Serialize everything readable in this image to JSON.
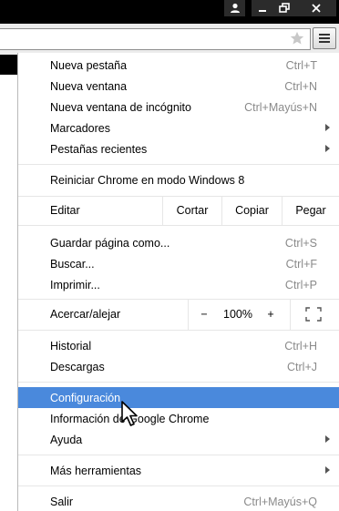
{
  "window": {
    "icons": {
      "user": "user-icon",
      "minimize": "minimize-icon",
      "restore": "restore-icon",
      "close": "close-icon"
    }
  },
  "toolbar": {
    "star_icon": "star-icon",
    "menu_icon": "hamburger-menu-icon"
  },
  "menu": {
    "group1": [
      {
        "label": "Nueva pestaña",
        "shortcut": "Ctrl+T"
      },
      {
        "label": "Nueva ventana",
        "shortcut": "Ctrl+N"
      },
      {
        "label": "Nueva ventana de incógnito",
        "shortcut": "Ctrl+Mayús+N"
      },
      {
        "label": "Marcadores",
        "shortcut": ""
      },
      {
        "label": "Pestañas recientes",
        "shortcut": ""
      }
    ],
    "restart": {
      "label": "Reiniciar Chrome en modo Windows 8"
    },
    "edit": {
      "label": "Editar",
      "cut": "Cortar",
      "copy": "Copiar",
      "paste": "Pegar"
    },
    "group2": [
      {
        "label": "Guardar página como...",
        "shortcut": "Ctrl+S"
      },
      {
        "label": "Buscar...",
        "shortcut": "Ctrl+F"
      },
      {
        "label": "Imprimir...",
        "shortcut": "Ctrl+P"
      }
    ],
    "zoom": {
      "label": "Acercar/alejar",
      "minus": "−",
      "value": "100%",
      "plus": "+"
    },
    "group3": [
      {
        "label": "Historial",
        "shortcut": "Ctrl+H"
      },
      {
        "label": "Descargas",
        "shortcut": "Ctrl+J"
      }
    ],
    "group4": [
      {
        "label": "Configuración",
        "shortcut": ""
      },
      {
        "label": "Información de Google Chrome",
        "shortcut": ""
      },
      {
        "label": "Ayuda",
        "shortcut": ""
      }
    ],
    "more_tools": {
      "label": "Más herramientas"
    },
    "exit": {
      "label": "Salir",
      "shortcut": "Ctrl+Mayús+Q"
    }
  },
  "colors": {
    "highlight": "#4a89dc",
    "shortcut_text": "#8a8a8a",
    "separator": "#e6e6e6"
  }
}
